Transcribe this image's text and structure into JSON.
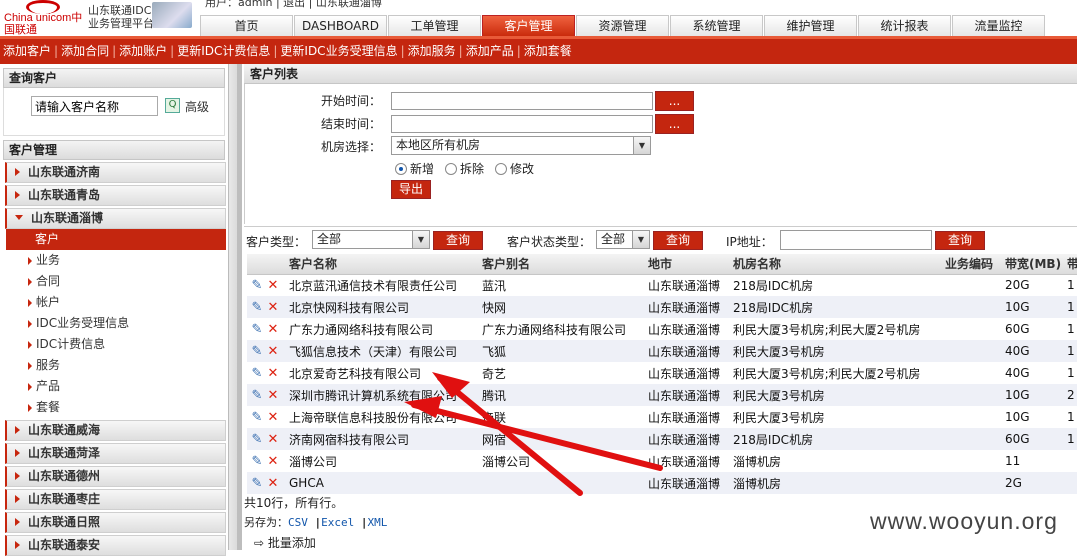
{
  "header": {
    "logo_brand": "China unicom中国联通",
    "logo_system": "山东联通IDC 业务管理平台",
    "top_text": "用户：admin | 退出 | 山东联通淄博",
    "nav": [
      "首页",
      "DASHBOARD",
      "工单管理",
      "客户管理",
      "资源管理",
      "系统管理",
      "维护管理",
      "统计报表",
      "流量监控"
    ],
    "active_nav": 3
  },
  "subnav": [
    "添加客户",
    "添加合同",
    "添加账户",
    "更新IDC计费信息",
    "更新IDC业务受理信息",
    "添加服务",
    "添加产品",
    "添加套餐"
  ],
  "sidebar": {
    "query_title": "查询客户",
    "search_value": "请输入客户名称",
    "advanced": "高级",
    "mgmt_title": "客户管理",
    "groups_top": [
      "山东联通济南",
      "山东联通青岛"
    ],
    "open_group": "山东联通淄博",
    "items": [
      "客户",
      "业务",
      "合同",
      "帐户",
      "IDC业务受理信息",
      "IDC计费信息",
      "服务",
      "产品",
      "套餐"
    ],
    "groups_bottom": [
      "山东联通威海",
      "山东联通菏泽",
      "山东联通德州",
      "山东联通枣庄",
      "山东联通日照",
      "山东联通泰安"
    ]
  },
  "main": {
    "title": "客户列表",
    "start_label": "开始时间：",
    "end_label": "结束时间：",
    "room_label": "机房选择：",
    "room_value": "本地区所有机房",
    "dots": "...",
    "radios": [
      "新增",
      "拆除",
      "修改"
    ],
    "radio_selected": 0,
    "export": "导出",
    "cust_type_label": "客户类型：",
    "cust_type_value": "全部",
    "query": "查询",
    "cust_status_label": "客户状态类型：",
    "cust_status_value": "全部",
    "ip_label": "IP地址："
  },
  "table": {
    "columns": [
      "客户名称",
      "客户别名",
      "地市",
      "机房名称",
      "业务编码",
      "带宽(MB)",
      "带"
    ],
    "rows": [
      [
        "北京蓝汛通信技术有限责任公司",
        "蓝汛",
        "山东联通淄博",
        "218局IDC机房",
        "",
        "20G",
        "1"
      ],
      [
        "北京快网科技有限公司",
        "快网",
        "山东联通淄博",
        "218局IDC机房",
        "",
        "10G",
        "1"
      ],
      [
        "广东力通网络科技有限公司",
        "广东力通网络科技有限公司",
        "山东联通淄博",
        "利民大厦3号机房;利民大厦2号机房",
        "",
        "60G",
        "1"
      ],
      [
        "飞狐信息技术（天津）有限公司",
        "飞狐",
        "山东联通淄博",
        "利民大厦3号机房",
        "",
        "40G",
        "1"
      ],
      [
        "北京爱奇艺科技有限公司",
        "奇艺",
        "山东联通淄博",
        "利民大厦3号机房;利民大厦2号机房",
        "",
        "40G",
        "1"
      ],
      [
        "深圳市腾讯计算机系统有限公司",
        "腾讯",
        "山东联通淄博",
        "利民大厦3号机房",
        "",
        "10G",
        "2"
      ],
      [
        "上海帝联信息科技股份有限公司",
        "帝联",
        "山东联通淄博",
        "利民大厦3号机房",
        "",
        "10G",
        "1"
      ],
      [
        "济南网宿科技有限公司",
        "网宿",
        "山东联通淄博",
        "218局IDC机房",
        "",
        "60G",
        "1"
      ],
      [
        "淄博公司",
        "淄博公司",
        "山东联通淄博",
        "淄博机房",
        "",
        "11",
        ""
      ],
      [
        "GHCA",
        "",
        "山东联通淄博",
        "淄博机房",
        "",
        "2G",
        ""
      ]
    ]
  },
  "footer": {
    "summary": "共10行，所有行。",
    "save_as": "另存为：",
    "formats": [
      "CSV",
      "Excel",
      "XML"
    ],
    "batch_add": "批量添加"
  },
  "watermark": "www.wooyun.org",
  "colors": {
    "brand_red": "#c4260f",
    "arrow_red": "#e01010"
  },
  "icons": {
    "edit": "edit-icon",
    "delete": "delete-icon",
    "search": "search-icon",
    "arrow": "arrow-right-icon"
  }
}
